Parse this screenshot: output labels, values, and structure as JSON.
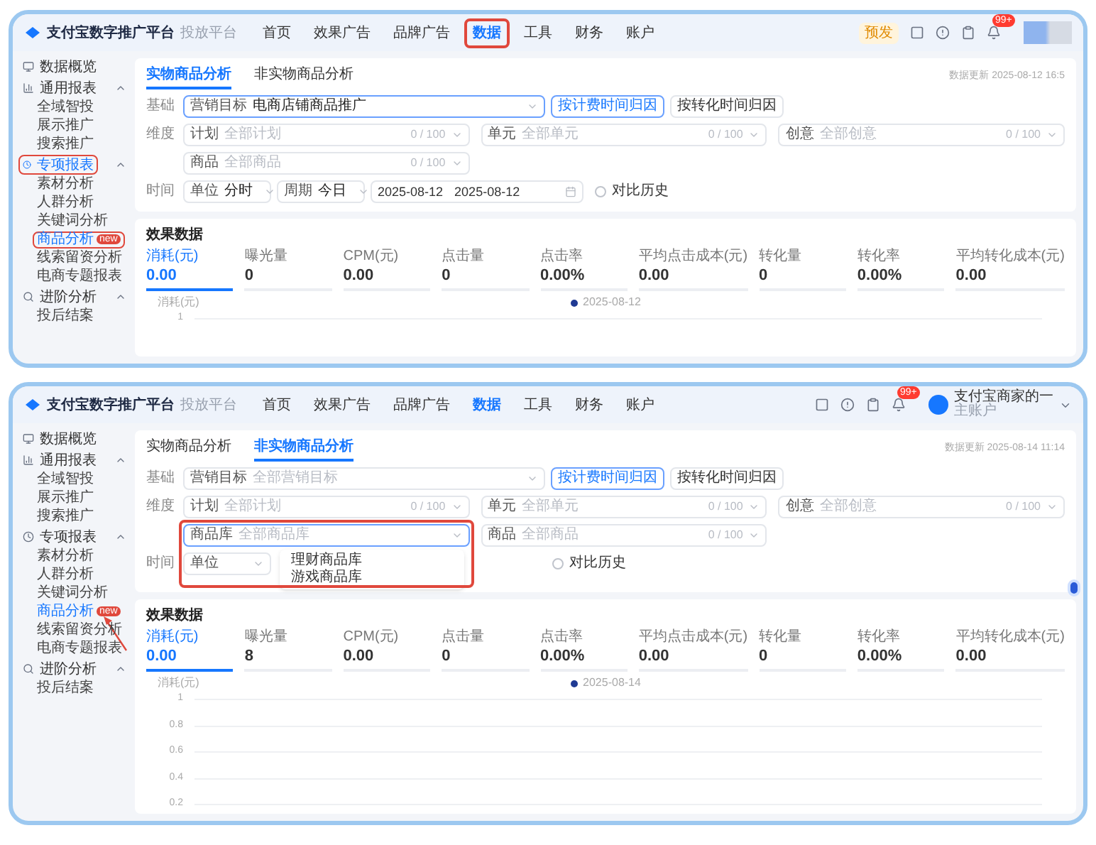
{
  "screens": [
    {
      "header": {
        "logo": "支付宝数字推广平台",
        "subtitle": "投放平台",
        "nav": [
          {
            "label": "首页",
            "selected": false,
            "highlighted": false
          },
          {
            "label": "效果广告",
            "selected": false,
            "highlighted": false
          },
          {
            "label": "品牌广告",
            "selected": false,
            "highlighted": false
          },
          {
            "label": "数据",
            "selected": true,
            "highlighted": true
          },
          {
            "label": "工具",
            "selected": false,
            "highlighted": false
          },
          {
            "label": "财务",
            "selected": false,
            "highlighted": false
          },
          {
            "label": "账户",
            "selected": false,
            "highlighted": false
          }
        ],
        "env_badge": "预发",
        "notification_count": "99+"
      },
      "sidebar": [
        {
          "label": "数据概览",
          "highlighted": false
        },
        {
          "label": "通用报表",
          "expanded": true,
          "highlighted": false,
          "children": [
            {
              "label": "全域智投",
              "selected": false
            },
            {
              "label": "展示推广",
              "selected": false
            },
            {
              "label": "搜索推广",
              "selected": false
            }
          ]
        },
        {
          "label": "专项报表",
          "expanded": true,
          "highlighted": true,
          "children": [
            {
              "label": "素材分析",
              "selected": false
            },
            {
              "label": "人群分析",
              "selected": false
            },
            {
              "label": "关键词分析",
              "selected": false
            },
            {
              "label": "商品分析",
              "selected": true,
              "badge": "new",
              "highlighted": true,
              "pointed": false
            },
            {
              "label": "线索留资分析",
              "selected": false
            },
            {
              "label": "电商专题报表",
              "selected": false
            }
          ]
        },
        {
          "label": "进阶分析",
          "expanded": true,
          "highlighted": false,
          "children": [
            {
              "label": "投后结案",
              "selected": false
            }
          ]
        }
      ],
      "tabs": [
        {
          "label": "实物商品分析",
          "selected": true
        },
        {
          "label": "非实物商品分析",
          "selected": false
        }
      ],
      "updated": "数据更新 2025-08-12 16:5",
      "filters": [
        {
          "label": "基础",
          "kind": "goal",
          "field": {
            "prefix": "营销目标",
            "value": "电商店铺商品推广",
            "focused": true
          },
          "buttons": [
            {
              "label": "按计费时间归因",
              "selected": true
            },
            {
              "label": "按转化时间归因",
              "selected": false
            }
          ]
        },
        {
          "label": "维度",
          "kind": "dimensions",
          "fields": [
            {
              "prefix": "计划",
              "placeholder": "全部计划",
              "count": "0 / 100"
            },
            {
              "prefix": "单元",
              "placeholder": "全部单元",
              "count": "0 / 100"
            },
            {
              "prefix": "创意",
              "placeholder": "全部创意",
              "count": "0 / 100"
            },
            {
              "prefix": "商品",
              "placeholder": "全部商品",
              "count": "0 / 100"
            }
          ]
        },
        {
          "label": "时间",
          "kind": "time",
          "fields": [
            {
              "prefix": "单位",
              "value": "分时"
            },
            {
              "prefix": "周期",
              "value": "今日"
            }
          ],
          "date_range": {
            "start": "2025-08-12",
            "end": "2025-08-12"
          },
          "checkbox": {
            "label": "对比历史",
            "checked": false
          }
        }
      ],
      "effect": {
        "title": "效果数据",
        "metrics": [
          {
            "label": "消耗(元)",
            "value": "0.00",
            "selected": true
          },
          {
            "label": "曝光量",
            "value": "0",
            "selected": false
          },
          {
            "label": "CPM(元)",
            "value": "0.00",
            "selected": false
          },
          {
            "label": "点击量",
            "value": "0",
            "selected": false
          },
          {
            "label": "点击率",
            "value": "0.00%",
            "selected": false
          },
          {
            "label": "平均点击成本(元)",
            "value": "0.00",
            "selected": false
          },
          {
            "label": "转化量",
            "value": "0",
            "selected": false
          },
          {
            "label": "转化率",
            "value": "0.00%",
            "selected": false
          },
          {
            "label": "平均转化成本(元)",
            "value": "0.00",
            "selected": false
          }
        ],
        "chart": {
          "y_label": "消耗(元)",
          "legend": "2025-08-12",
          "yticks": [
            "1"
          ]
        }
      }
    },
    {
      "header": {
        "logo": "支付宝数字推广平台",
        "subtitle": "投放平台",
        "nav": [
          {
            "label": "首页",
            "selected": false,
            "highlighted": false
          },
          {
            "label": "效果广告",
            "selected": false,
            "highlighted": false
          },
          {
            "label": "品牌广告",
            "selected": false,
            "highlighted": false
          },
          {
            "label": "数据",
            "selected": true,
            "highlighted": false
          },
          {
            "label": "工具",
            "selected": false,
            "highlighted": false
          },
          {
            "label": "财务",
            "selected": false,
            "highlighted": false
          },
          {
            "label": "账户",
            "selected": false,
            "highlighted": false
          }
        ],
        "notification_count": "99+",
        "user": {
          "name": "支付宝商家的一",
          "role": "主账户"
        }
      },
      "sidebar": [
        {
          "label": "数据概览",
          "highlighted": false
        },
        {
          "label": "通用报表",
          "expanded": true,
          "highlighted": false,
          "children": [
            {
              "label": "全域智投",
              "selected": false
            },
            {
              "label": "展示推广",
              "selected": false
            },
            {
              "label": "搜索推广",
              "selected": false
            }
          ]
        },
        {
          "label": "专项报表",
          "expanded": true,
          "highlighted": false,
          "children": [
            {
              "label": "素材分析",
              "selected": false
            },
            {
              "label": "人群分析",
              "selected": false
            },
            {
              "label": "关键词分析",
              "selected": false
            },
            {
              "label": "商品分析",
              "selected": true,
              "badge": "new",
              "highlighted": false,
              "pointed": true
            },
            {
              "label": "线索留资分析",
              "selected": false
            },
            {
              "label": "电商专题报表",
              "selected": false
            }
          ]
        },
        {
          "label": "进阶分析",
          "expanded": true,
          "highlighted": false,
          "children": [
            {
              "label": "投后结案",
              "selected": false
            }
          ]
        }
      ],
      "tabs": [
        {
          "label": "实物商品分析",
          "selected": false
        },
        {
          "label": "非实物商品分析",
          "selected": true
        }
      ],
      "updated": "数据更新 2025-08-14 11:14",
      "filters": [
        {
          "label": "基础",
          "kind": "goal",
          "field": {
            "prefix": "营销目标",
            "placeholder": "全部营销目标",
            "focused": false
          },
          "buttons": [
            {
              "label": "按计费时间归因",
              "selected": true
            },
            {
              "label": "按转化时间归因",
              "selected": false
            }
          ]
        },
        {
          "label": "维度",
          "kind": "dimensions",
          "fields": [
            {
              "prefix": "计划",
              "placeholder": "全部计划",
              "count": "0 / 100"
            },
            {
              "prefix": "单元",
              "placeholder": "全部单元",
              "count": "0 / 100"
            },
            {
              "prefix": "创意",
              "placeholder": "全部创意",
              "count": "0 / 100"
            },
            {
              "prefix": "商品库",
              "placeholder": "全部商品库",
              "focused": true,
              "highlighted": true,
              "options": [
                "理财商品库",
                "游戏商品库"
              ]
            },
            {
              "prefix": "商品",
              "placeholder": "全部商品",
              "count": "0 / 100"
            }
          ]
        },
        {
          "label": "时间",
          "kind": "time",
          "fields": [
            {
              "prefix": "单位"
            }
          ],
          "checkbox": {
            "label": "对比历史",
            "checked": false
          }
        }
      ],
      "effect": {
        "title": "效果数据",
        "metrics": [
          {
            "label": "消耗(元)",
            "value": "0.00",
            "selected": true
          },
          {
            "label": "曝光量",
            "value": "8",
            "selected": false
          },
          {
            "label": "CPM(元)",
            "value": "0.00",
            "selected": false
          },
          {
            "label": "点击量",
            "value": "0",
            "selected": false
          },
          {
            "label": "点击率",
            "value": "0.00%",
            "selected": false
          },
          {
            "label": "平均点击成本(元)",
            "value": "0.00",
            "selected": false
          },
          {
            "label": "转化量",
            "value": "0",
            "selected": false
          },
          {
            "label": "转化率",
            "value": "0.00%",
            "selected": false
          },
          {
            "label": "平均转化成本(元)",
            "value": "0.00",
            "selected": false
          }
        ],
        "chart": {
          "y_label": "消耗(元)",
          "legend": "2025-08-14",
          "yticks": [
            "1",
            "0.8",
            "0.6",
            "0.4",
            "0.2"
          ]
        }
      }
    }
  ]
}
